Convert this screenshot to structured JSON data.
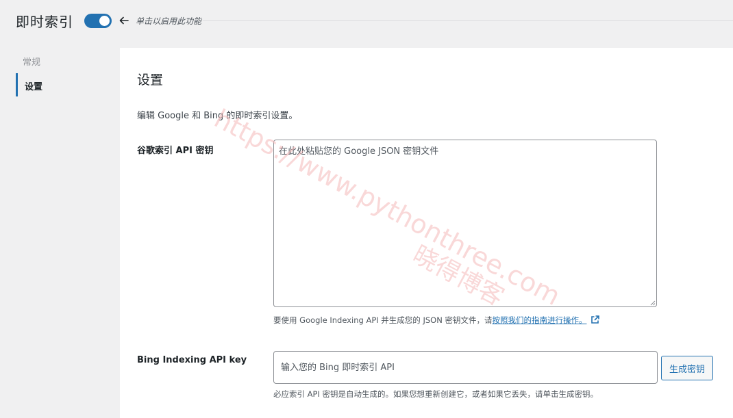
{
  "header": {
    "title": "即时索引",
    "toggle_on": true,
    "hint": "单击以启用此功能"
  },
  "sidebar": {
    "heading": "常规",
    "items": [
      {
        "label": "设置",
        "active": true
      }
    ]
  },
  "main": {
    "title": "设置",
    "description": "编辑 Google 和 Bing 的即时索引设置。",
    "google": {
      "label": "谷歌索引 API 密钥",
      "placeholder": "在此处粘贴您的 Google JSON 密钥文件",
      "help_prefix": "要使用 Google Indexing API 并生成您的 JSON 密钥文件，请",
      "help_link": "按照我们的指南进行操作。"
    },
    "bing": {
      "label": "Bing Indexing API key",
      "placeholder": "输入您的 Bing 即时索引 API",
      "button_label": "生成密钥",
      "help": "必应索引 API 密钥是自动生成的。如果您想重新创建它，或者如果它丢失，请单击生成密钥。"
    }
  },
  "watermark": {
    "url": "https://www.pythonthree.com",
    "name": "晓得博客"
  },
  "colors": {
    "accent": "#2271b1",
    "watermark": "#f4b8b8"
  }
}
